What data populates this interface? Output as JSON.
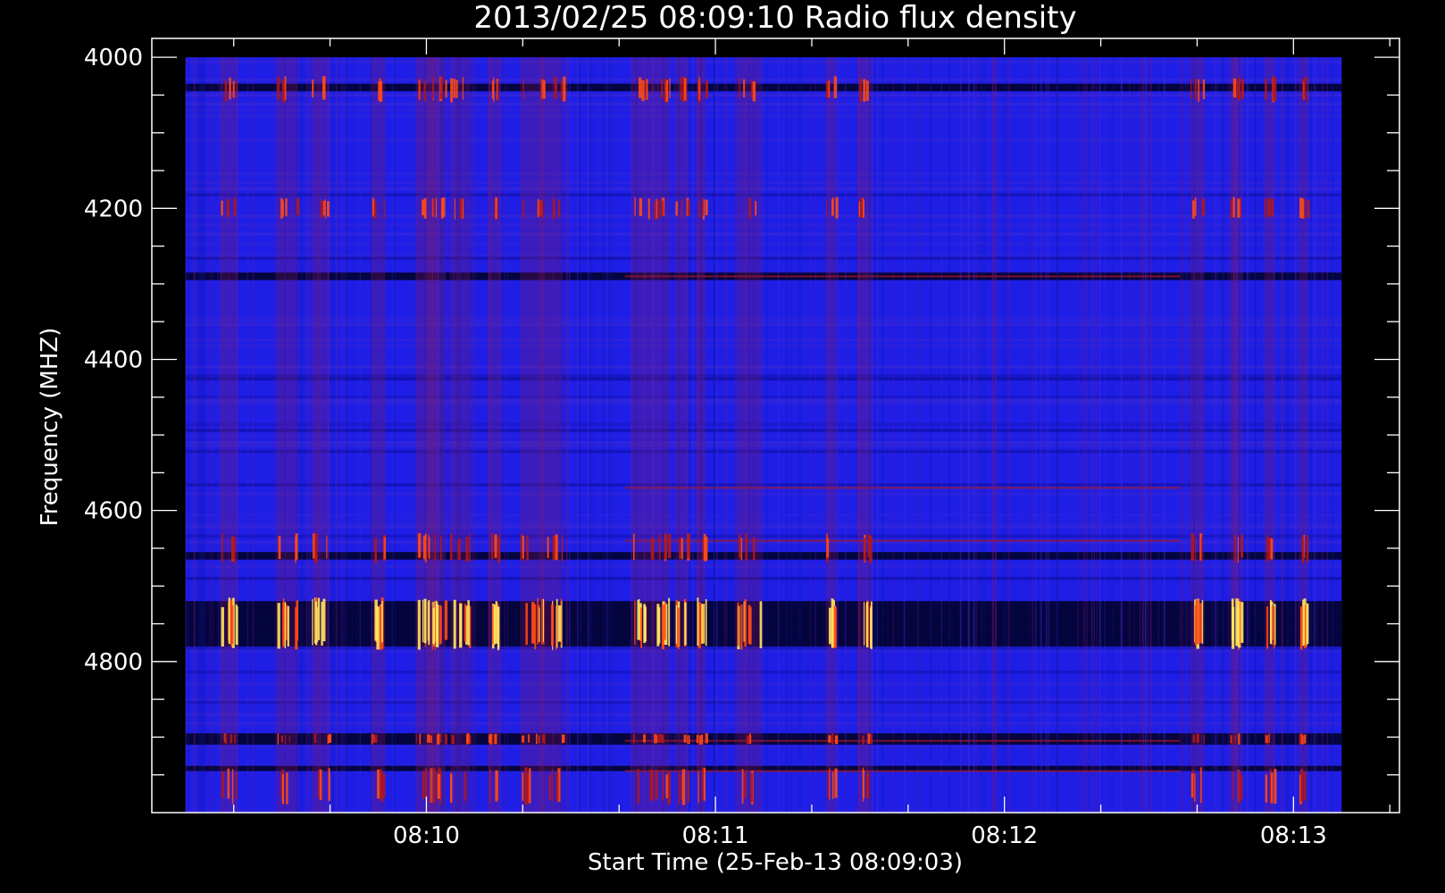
{
  "chart_data": {
    "type": "heatmap",
    "title": "2013/02/25 08:09:10 Radio flux density",
    "xlabel": "Start Time (25-Feb-13 08:09:03)",
    "ylabel": "Frequency (MHZ)",
    "x_start": "08:09:10",
    "x_end": "08:13:10",
    "x_ticks": [
      "08:10",
      "08:11",
      "08:12",
      "08:13"
    ],
    "x_range": [
      "08:09:03",
      "08:13:22"
    ],
    "y_ticks": [
      4000,
      4200,
      4400,
      4600,
      4800
    ],
    "y_range": [
      3975,
      5000
    ],
    "y_reversed": true,
    "data_y_range": [
      4000,
      5000
    ],
    "colors": {
      "background": "#000000",
      "axes": "#ffffff",
      "base": "#1e1ee6",
      "absorption": "#000020",
      "weak": "#b01818",
      "medium": "#ff4a14",
      "strong": "#ffe860"
    },
    "dark_bands_mhz": [
      [
        4035,
        4045
      ],
      [
        4285,
        4295
      ],
      [
        4655,
        4665
      ],
      [
        4720,
        4780
      ],
      [
        4895,
        4910
      ],
      [
        4938,
        4945
      ]
    ],
    "bright_band_mhz": [
      4720,
      4780
    ],
    "burst_times": [
      "08:09:19",
      "08:09:31",
      "08:09:38",
      "08:09:50",
      "08:10:00",
      "08:10:02",
      "08:10:07",
      "08:10:14",
      "08:10:22",
      "08:10:26",
      "08:10:45",
      "08:10:49",
      "08:10:53",
      "08:10:57",
      "08:11:07",
      "08:11:24",
      "08:11:31",
      "08:12:40",
      "08:12:48",
      "08:12:55",
      "08:13:02"
    ]
  }
}
